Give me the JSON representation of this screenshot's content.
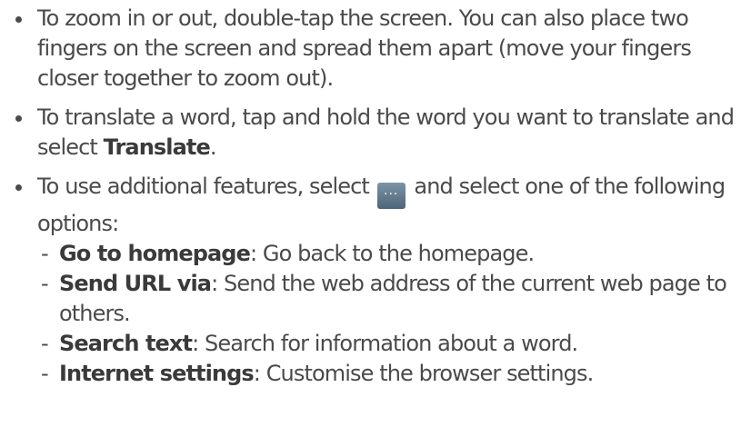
{
  "bullets": {
    "zoom": {
      "text": "To zoom in or out, double-tap the screen. You can also place two fingers on the screen and spread them apart (move your fingers closer together to zoom out)."
    },
    "translate": {
      "text_before": "To translate a word, tap and hold the word you want to translate and select ",
      "bold": "Translate",
      "text_after": "."
    },
    "features": {
      "text_before": "To use additional features, select ",
      "icon": "more-menu-icon",
      "icon_glyph": "···",
      "text_after": " and select one of the following options:",
      "options": [
        {
          "term": "Go to homepage",
          "desc": ": Go back to the homepage."
        },
        {
          "term": "Send URL via",
          "desc": ": Send the web address of the current web page to others."
        },
        {
          "term": "Search text",
          "desc": ": Search for information about a word."
        },
        {
          "term": "Internet settings",
          "desc": ": Customise the browser settings."
        }
      ]
    }
  },
  "dash": "-"
}
